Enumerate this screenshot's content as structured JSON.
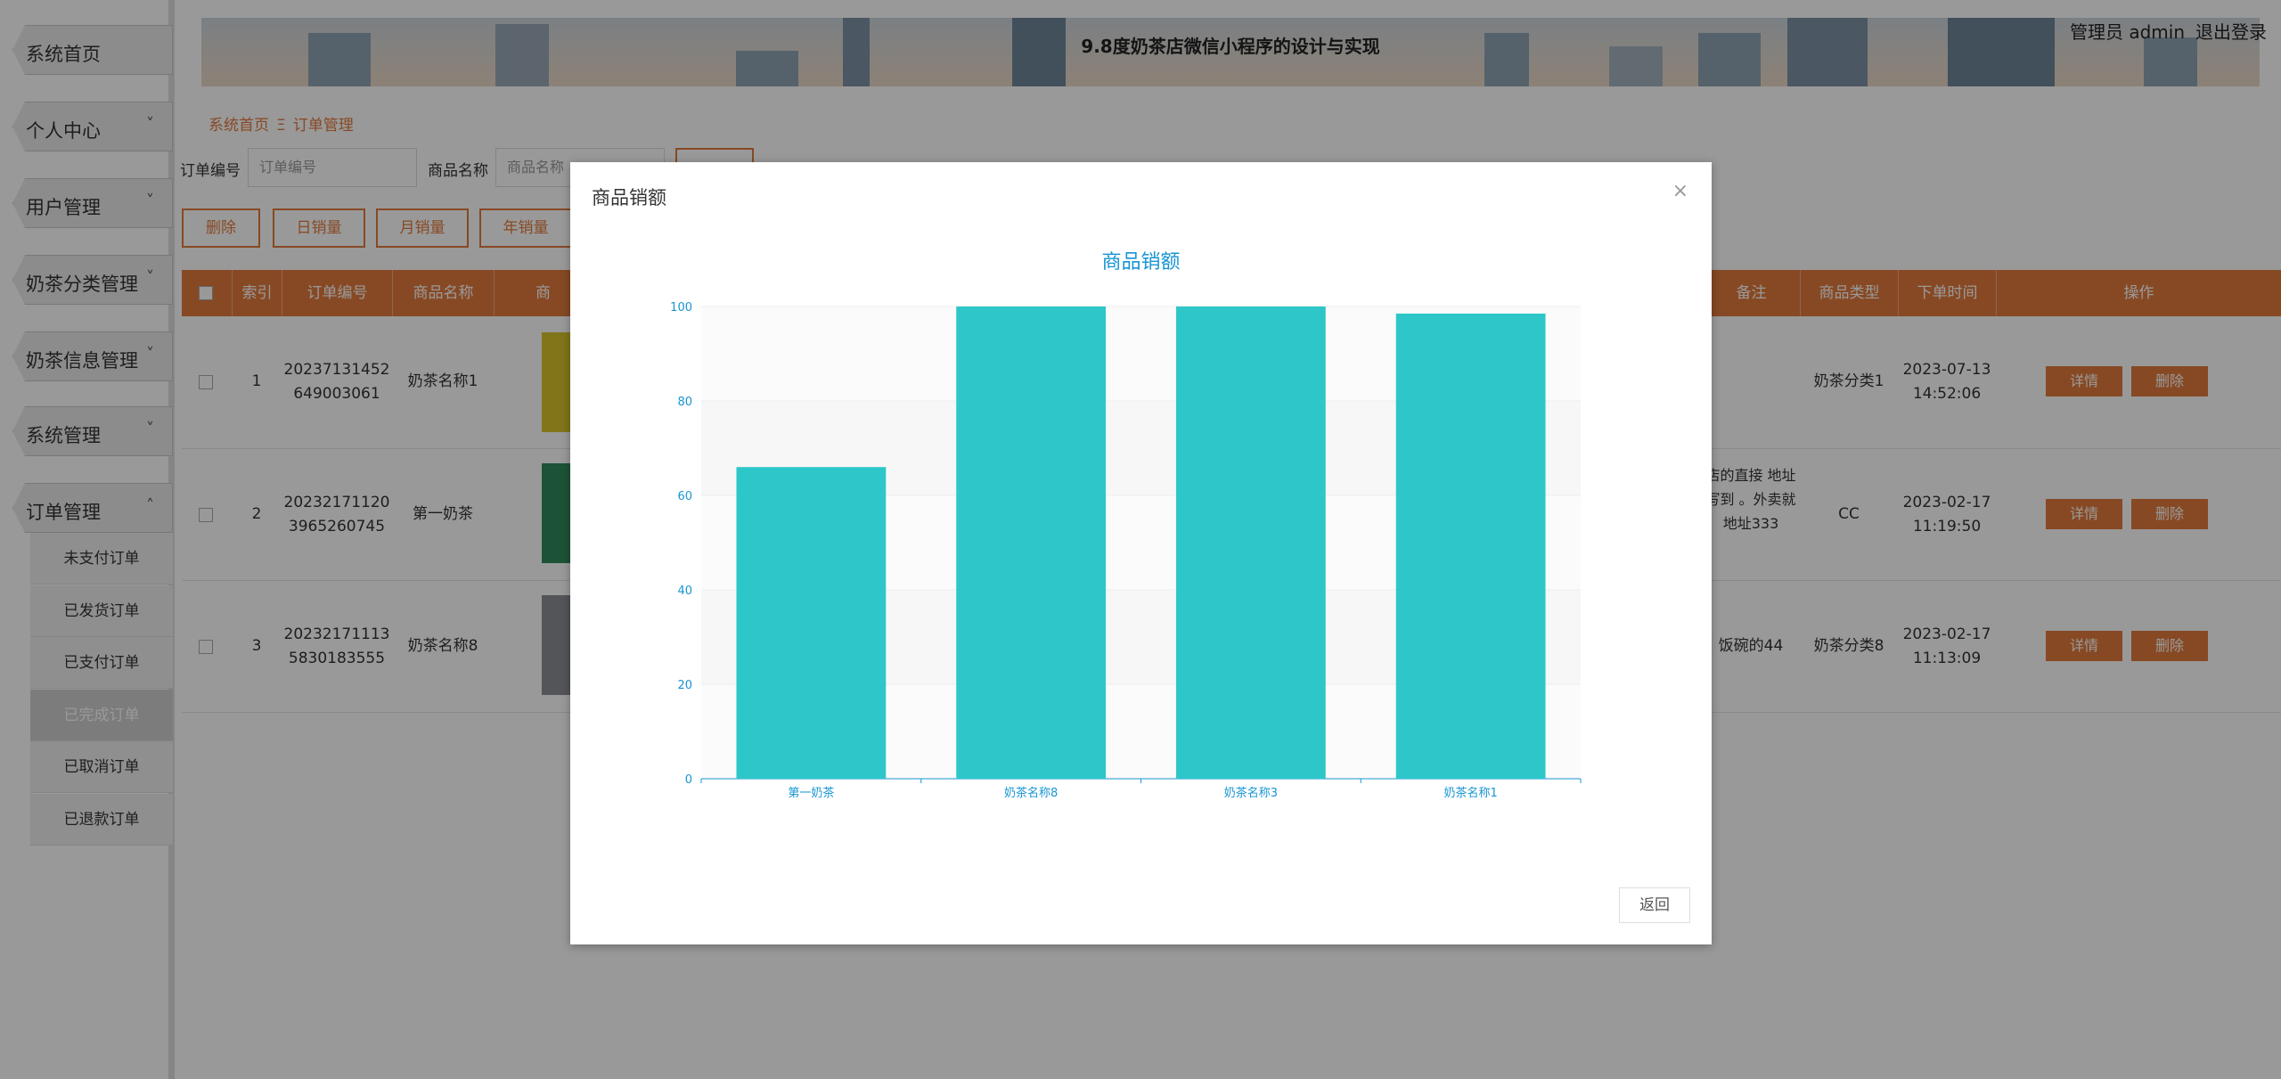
{
  "header": {
    "title": "9.8度奶茶店微信小程序的设计与实现",
    "user": "管理员 admin",
    "logout": "退出登录"
  },
  "sidebar": {
    "menus": [
      {
        "label": "系统首页",
        "chevron": ""
      },
      {
        "label": "个人中心",
        "chevron": "˅"
      },
      {
        "label": "用户管理",
        "chevron": "˅"
      },
      {
        "label": "奶茶分类管理",
        "chevron": "˅"
      },
      {
        "label": "奶茶信息管理",
        "chevron": "˅"
      },
      {
        "label": "系统管理",
        "chevron": "˅"
      },
      {
        "label": "订单管理",
        "chevron": "˄"
      }
    ],
    "submenu": [
      "未支付订单",
      "已发货订单",
      "已支付订单",
      "已完成订单",
      "已取消订单",
      "已退款订单"
    ]
  },
  "breadcrumb": {
    "home": "系统首页",
    "sep": "Ξ",
    "current": "订单管理"
  },
  "search": {
    "order_label": "订单编号",
    "order_placeholder": "订单编号",
    "product_label": "商品名称",
    "product_placeholder": "商品名称"
  },
  "actions": [
    "删除",
    "日销量",
    "月销量",
    "年销量"
  ],
  "table": {
    "headers": {
      "index": "索引",
      "order": "订单编号",
      "name": "商品名称",
      "pic": "商",
      "note": "备注",
      "type": "商品类型",
      "time": "下单时间",
      "op": "操作"
    },
    "rows": [
      {
        "index": "1",
        "order": "20237131452649003061",
        "name": "奶茶名称1",
        "note": "",
        "type": "奶茶分类1",
        "time": "2023-07-13 14:52:06"
      },
      {
        "index": "2",
        "order": "202321711203965260745",
        "name": "第一奶茶",
        "note": "店的直接 地址写到 。外卖就 地址333",
        "type": "CC",
        "time": "2023-02-17 11:19:50"
      },
      {
        "index": "3",
        "order": "202321711135830183555",
        "name": "奶茶名称8",
        "note": "饭碗的44",
        "type": "奶茶分类8",
        "time": "2023-02-17 11:13:09"
      }
    ],
    "detail": "详情",
    "delete": "删除"
  },
  "modal": {
    "title": "商品销额",
    "close": "×",
    "return": "返回"
  },
  "colors": {
    "accent": "#e27a3c",
    "bar": "#2ec7c9",
    "chart_text": "#1795d3"
  },
  "chart_data": {
    "type": "bar",
    "title": "商品销额",
    "categories": [
      "第一奶茶",
      "奶茶名称8",
      "奶茶名称3",
      "奶茶名称1"
    ],
    "values": [
      66,
      100,
      100,
      98.5
    ],
    "ylim": [
      0,
      100
    ],
    "yticks": [
      0,
      20,
      40,
      60,
      80,
      100
    ],
    "grid": true
  }
}
